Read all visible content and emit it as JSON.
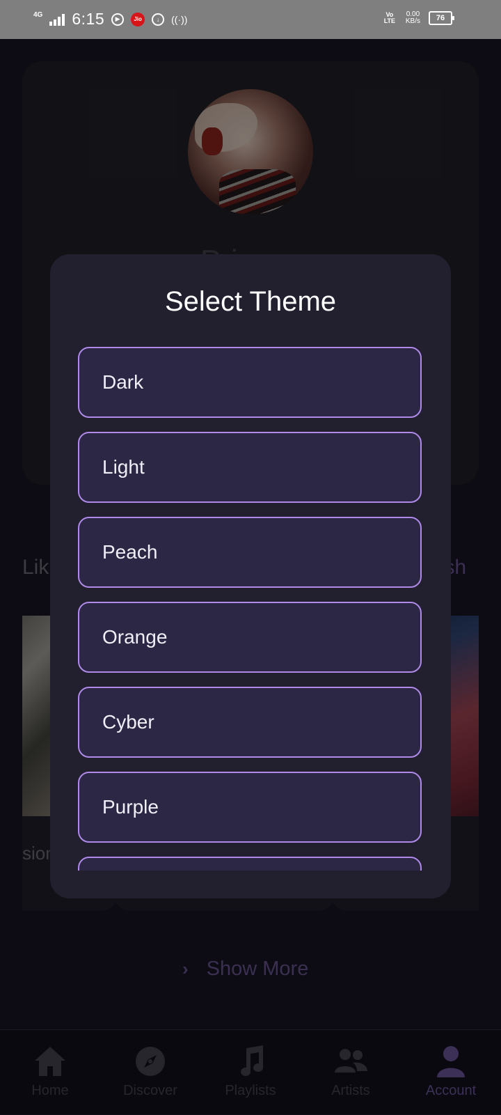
{
  "status_bar": {
    "network": "4G",
    "time": "6:15",
    "jio_label": "Jio",
    "volte": "Vo LTE",
    "speed_value": "0.00",
    "speed_unit": "KB/s",
    "battery": "76"
  },
  "profile": {
    "name_partial": "Pri"
  },
  "liked": {
    "title_partial": "Lik",
    "refresh_partial": "sh",
    "tile_subtitle_partial": "sion"
  },
  "show_more": {
    "label": "Show More"
  },
  "dialog": {
    "title": "Select Theme",
    "options": [
      "Dark",
      "Light",
      "Peach",
      "Orange",
      "Cyber",
      "Purple",
      ""
    ]
  },
  "nav": {
    "items": [
      {
        "label": "Home",
        "icon": "home-icon"
      },
      {
        "label": "Discover",
        "icon": "compass-icon"
      },
      {
        "label": "Playlists",
        "icon": "music-note-icon"
      },
      {
        "label": "Artists",
        "icon": "people-icon"
      },
      {
        "label": "Account",
        "icon": "person-icon"
      }
    ],
    "active": "Account",
    "active_color": "#5c4a85"
  },
  "colors": {
    "accent_border": "#b08ae8",
    "dialog_bg": "#221f2f",
    "option_bg": "#2b2745",
    "page_bg": "#14121e"
  }
}
